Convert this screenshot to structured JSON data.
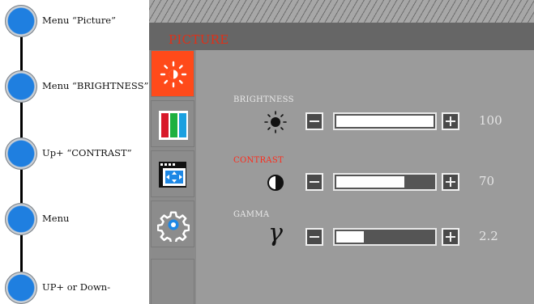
{
  "steps": [
    {
      "label": "Menu  “Picture”"
    },
    {
      "label": "Menu  “BRIGHTNESS”"
    },
    {
      "label": "Up+  “CONTRAST”"
    },
    {
      "label": "Menu"
    },
    {
      "label": "UP+ or Down-"
    }
  ],
  "osd": {
    "title": "PICTURE",
    "tabs": [
      {
        "icon": "brightness-sun-icon",
        "active": true
      },
      {
        "icon": "color-bars-icon",
        "active": false
      },
      {
        "icon": "image-size-icon",
        "active": false
      },
      {
        "icon": "settings-gear-icon",
        "active": false
      },
      {
        "icon": "blank",
        "active": false
      }
    ],
    "rows": [
      {
        "title": "BRIGHTNESS",
        "icon": "sun-icon",
        "value": "100",
        "level": 1.0,
        "title_color": "#e8e8e8"
      },
      {
        "title": "CONTRAST",
        "icon": "half-circle-contrast-icon",
        "value": "70",
        "level": 0.7,
        "title_color": "#ff2a1a"
      },
      {
        "title": "GAMMA",
        "icon": "gamma-icon",
        "value": "2.2",
        "level": 0.28,
        "title_color": "#e8e8e8"
      }
    ],
    "gamma_symbol": "γ",
    "colors": {
      "accent": "#e03018",
      "active_tab": "#ff4a1a",
      "panel": "#9b9b9b",
      "step_button": "#1f7fe0"
    }
  }
}
